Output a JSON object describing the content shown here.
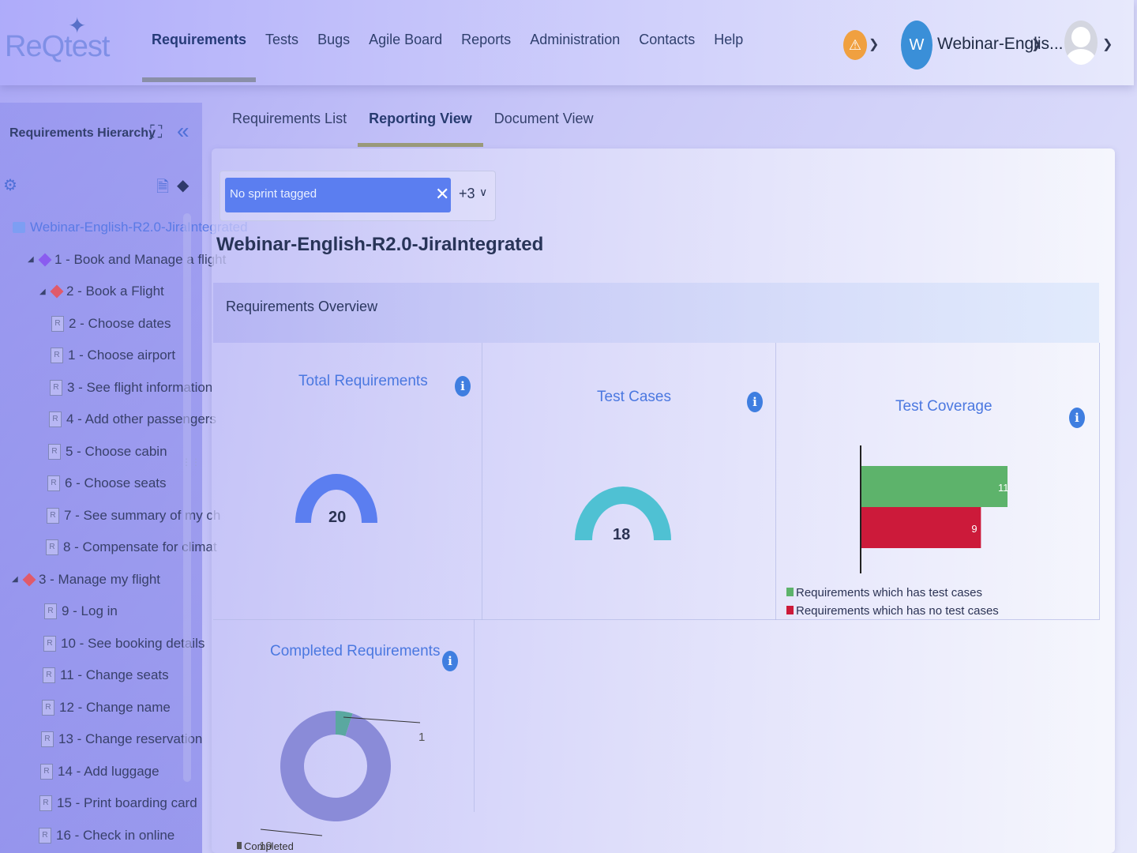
{
  "app": {
    "logo": "ReQtest"
  },
  "nav": {
    "items": [
      "Requirements",
      "Tests",
      "Bugs",
      "Agile Board",
      "Reports",
      "Administration",
      "Contacts",
      "Help"
    ],
    "active_index": 0
  },
  "header": {
    "workspace_initial": "W",
    "workspace_name": "Webinar-Englis...",
    "alert_icon": "warning-icon"
  },
  "sidebar": {
    "title": "Requirements Hierarchy",
    "tree": [
      {
        "label": "Webinar-English-R2.0-JiraIntegrated",
        "kind": "root"
      },
      {
        "label": "1 - Book and Manage a flight",
        "kind": "epic",
        "color": "#8a5cf0"
      },
      {
        "label": "2 - Book a Flight",
        "kind": "epic",
        "color": "#e05a6a"
      },
      {
        "label": "2 - Choose dates",
        "kind": "req"
      },
      {
        "label": "1 - Choose airport",
        "kind": "req"
      },
      {
        "label": "3 - See flight information",
        "kind": "req"
      },
      {
        "label": "4 - Add other passengers",
        "kind": "req"
      },
      {
        "label": "5 - Choose cabin",
        "kind": "req"
      },
      {
        "label": "6 - Choose seats",
        "kind": "req"
      },
      {
        "label": "7 - See summary of my ch",
        "kind": "req"
      },
      {
        "label": "8 - Compensate for climat",
        "kind": "req"
      },
      {
        "label": "3 - Manage my flight",
        "kind": "epic",
        "color": "#e05a6a"
      },
      {
        "label": "9 - Log in",
        "kind": "req"
      },
      {
        "label": "10 - See booking details",
        "kind": "req"
      },
      {
        "label": "11 - Change seats",
        "kind": "req"
      },
      {
        "label": "12 - Change name",
        "kind": "req"
      },
      {
        "label": "13 - Change reservation",
        "kind": "req"
      },
      {
        "label": "14 - Add luggage",
        "kind": "req"
      },
      {
        "label": "15 - Print boarding card",
        "kind": "req"
      },
      {
        "label": "16 - Check in online",
        "kind": "req"
      }
    ]
  },
  "subtabs": {
    "items": [
      "Requirements List",
      "Reporting View",
      "Document View"
    ],
    "active_index": 1
  },
  "filter": {
    "chip": "No sprint tagged",
    "more": "+3"
  },
  "project_title": "Webinar-English-R2.0-JiraIntegrated",
  "overview": {
    "title": "Requirements Overview",
    "cards": {
      "total": {
        "title": "Total Requirements",
        "value": "20",
        "color": "#5b7ef0"
      },
      "tests": {
        "title": "Test Cases",
        "value": "18",
        "color": "#4fc1d3"
      },
      "coverage": {
        "title": "Test Coverage"
      },
      "completed": {
        "title": "Completed Requirements"
      }
    }
  },
  "chart_data": [
    {
      "type": "bar",
      "title": "Test Coverage",
      "orientation": "horizontal",
      "categories": [
        "Requirements which has test cases",
        "Requirements which has no test cases"
      ],
      "values": [
        11,
        9
      ],
      "colors": [
        "#5db36b",
        "#cc1a3a"
      ],
      "legend": "bottom"
    },
    {
      "type": "pie",
      "title": "Completed Requirements",
      "donut": true,
      "slices": [
        {
          "label": "Completed",
          "value": 1,
          "color": "#5aa8a0"
        },
        {
          "label": "",
          "value": 19,
          "color": "#8a8bd8"
        }
      ],
      "data_labels": [
        "1",
        "19"
      ],
      "legend": [
        "Completed"
      ]
    }
  ]
}
